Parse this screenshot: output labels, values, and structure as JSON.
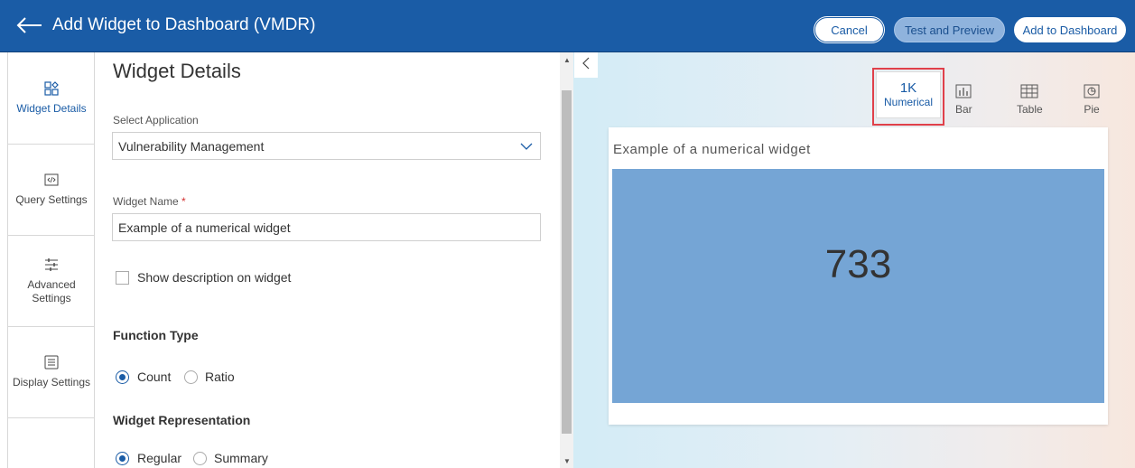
{
  "header": {
    "title": "Add Widget to Dashboard (VMDR)",
    "cancel_label": "Cancel",
    "preview_label": "Test and Preview",
    "add_label": "Add to Dashboard"
  },
  "sidebar": {
    "items": [
      {
        "label": "Widget Details",
        "icon": "widget-grid-icon",
        "active": true
      },
      {
        "label": "Query Settings",
        "icon": "code-icon"
      },
      {
        "label": "Advanced Settings",
        "icon": "sliders-icon"
      },
      {
        "label": "Display Settings",
        "icon": "display-icon"
      }
    ]
  },
  "form": {
    "section_title": "Widget Details",
    "application_label": "Select Application",
    "application_value": "Vulnerability Management",
    "widget_name_label": "Widget Name",
    "required_mark": "*",
    "widget_name_value": "Example of a numerical widget",
    "show_description_label": "Show description on widget",
    "show_description_checked": false,
    "function_type_title": "Function Type",
    "function_options": [
      "Count",
      "Ratio"
    ],
    "function_selected": "Count",
    "representation_title": "Widget Representation",
    "representation_options": [
      "Regular",
      "Summary"
    ],
    "representation_selected": "Regular"
  },
  "preview": {
    "widget_types": [
      {
        "big": "1K",
        "label": "Numerical",
        "selected": true
      },
      {
        "label": "Bar",
        "icon": "bar-chart-icon"
      },
      {
        "label": "Table",
        "icon": "table-icon"
      },
      {
        "label": "Pie",
        "icon": "pie-chart-icon"
      }
    ],
    "card_title": "Example of a numerical widget",
    "card_value": "733"
  },
  "colors": {
    "header_bg": "#1a5ca6",
    "accent": "#1a5ca6",
    "card_body": "#75a5d5",
    "highlight_box": "#e0404a"
  }
}
